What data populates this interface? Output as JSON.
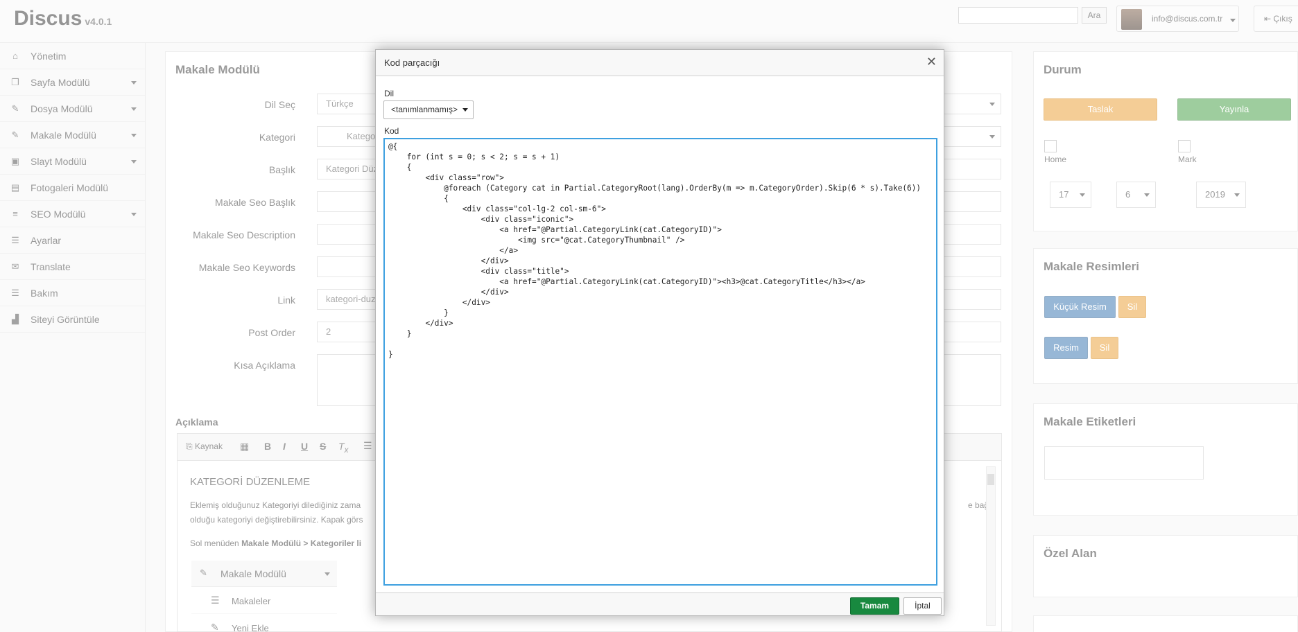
{
  "app": {
    "brand": "Discus",
    "version": "v4.0.1"
  },
  "topbar": {
    "search_button": "Ara",
    "user_email": "info@discus.com.tr",
    "exit_label": "Çıkış"
  },
  "sidebar": {
    "items": [
      {
        "label": "Yönetim",
        "icon": "home-icon",
        "glyph": "⌂"
      },
      {
        "label": "Sayfa Modülü",
        "icon": "pages-icon",
        "glyph": "❐"
      },
      {
        "label": "Dosya Modülü",
        "icon": "pin-icon",
        "glyph": "✎"
      },
      {
        "label": "Makale Modülü",
        "icon": "pin-icon",
        "glyph": "✎"
      },
      {
        "label": "Slayt Modülü",
        "icon": "image-icon",
        "glyph": "▣"
      },
      {
        "label": "Fotogaleri Modülü",
        "icon": "gallery-icon",
        "glyph": "▤"
      },
      {
        "label": "SEO Modülü",
        "icon": "list-icon",
        "glyph": "≡"
      },
      {
        "label": "Ayarlar",
        "icon": "sliders-icon",
        "glyph": "☰"
      },
      {
        "label": "Translate",
        "icon": "chat-icon",
        "glyph": "✉"
      },
      {
        "label": "Bakım",
        "icon": "sliders-icon",
        "glyph": "☰"
      },
      {
        "label": "Siteyi Görüntüle",
        "icon": "chart-icon",
        "glyph": "▟"
      }
    ]
  },
  "main": {
    "title": "Makale Modülü",
    "fields": {
      "lang_label": "Dil Seç",
      "lang_value": "Türkçe",
      "category_label": "Kategori",
      "category_value": "Kategori",
      "title_label": "Başlık",
      "title_value": "Kategori Düz",
      "seo_title_label": "Makale Seo Başlık",
      "seo_desc_label": "Makale Seo Description",
      "seo_keywords_label": "Makale Seo Keywords",
      "link_label": "Link",
      "link_value": "kategori-duz",
      "post_order_label": "Post Order",
      "post_order_value": "2",
      "short_desc_label": "Kısa Açıklama",
      "desc_label": "Açıklama"
    },
    "editor": {
      "source_label": "Kaynak",
      "heading": "KATEGORİ DÜZENLEME",
      "para1": "Eklemiş olduğunuz Kategoriyi dilediğiniz zama",
      "para1_tail": "e bağlı",
      "para2": "olduğu kategoriyi değiştirebilirsiniz. Kapak görs",
      "para3_prefix": "Sol menüden ",
      "para3_bold": "Makale Modülü > Kategoriler li",
      "menu_root": "Makale Modülü",
      "menu_item1": "Makaleler",
      "menu_item2": "Yeni Ekle"
    }
  },
  "status": {
    "title": "Durum",
    "draft_button": "Taslak",
    "publish_button": "Yayınla",
    "home_label": "Home",
    "mark_label": "Mark",
    "day": "17",
    "month": "6",
    "year": "2019"
  },
  "images": {
    "title": "Makale Resimleri",
    "small_image_button": "Küçük Resim",
    "delete1": "Sil",
    "image_button": "Resim",
    "delete2": "Sil"
  },
  "tags": {
    "title": "Makale Etiketleri"
  },
  "custom": {
    "title": "Özel Alan"
  },
  "dialog": {
    "title": "Kod parçacığı",
    "lang_label": "Dil",
    "lang_value": "<tanımlanmamış>",
    "code_label": "Kod",
    "code": "@{\n    for (int s = 0; s < 2; s = s + 1)\n    {\n        <div class=\"row\">\n            @foreach (Category cat in Partial.CategoryRoot(lang).OrderBy(m => m.CategoryOrder).Skip(6 * s).Take(6))\n            {\n                <div class=\"col-lg-2 col-sm-6\">\n                    <div class=\"iconic\">\n                        <a href=\"@Partial.CategoryLink(cat.CategoryID)\">\n                            <img src=\"@cat.CategoryThumbnail\" />\n                        </a>\n                    </div>\n                    <div class=\"title\">\n                        <a href=\"@Partial.CategoryLink(cat.CategoryID)\"><h3>@cat.CategoryTitle</h3></a>\n                    </div>\n                </div>\n            }\n        </div>\n    }\n\n}",
    "ok_button": "Tamam",
    "cancel_button": "İptal",
    "close_glyph": "✕"
  }
}
